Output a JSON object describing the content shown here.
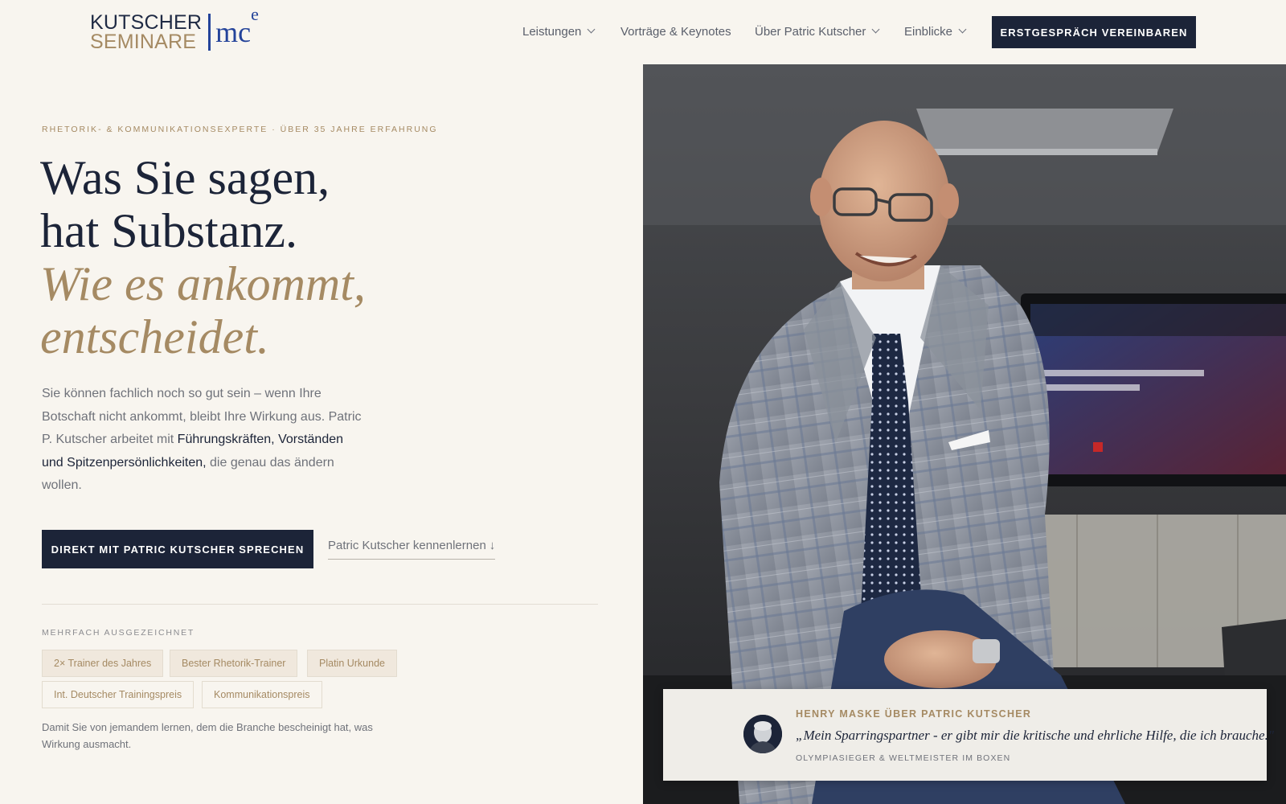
{
  "logo": {
    "line1": "KUTSCHER",
    "line2": "SEMINARE",
    "mark": "mc",
    "mark_sup": "e"
  },
  "nav": {
    "items": [
      {
        "label": "Leistungen",
        "has_dropdown": true
      },
      {
        "label": "Vorträge & Keynotes",
        "has_dropdown": false
      },
      {
        "label": "Über Patric Kutscher",
        "has_dropdown": true
      },
      {
        "label": "Einblicke",
        "has_dropdown": true
      }
    ],
    "cta_label": "ERSTGESPRÄCH VEREINBAREN"
  },
  "hero": {
    "eyebrow": "RHETORIK- & KOMMUNIKATIONSEXPERTE · ÜBER 35 JAHRE ERFAHRUNG",
    "headline": {
      "line1": "Was Sie sagen,",
      "line2": "hat Substanz.",
      "line3": "Wie es ankommt,",
      "line4": "entscheidet."
    },
    "lead": {
      "part1": "Sie können fachlich noch so gut sein – wenn Ihre Botschaft nicht ankommt, bleibt Ihre Wirkung aus. Patric P. Kutscher arbeitet mit ",
      "strong": "Führungskräften, Vorständen und Spitzenpersönlichkeiten,",
      "part2": " die genau das ändern wollen."
    },
    "cta_primary": "DIREKT MIT PATRIC KUTSCHER SPRECHEN",
    "cta_secondary": "Patric Kutscher kennenlernen",
    "cta_secondary_icon": "↓"
  },
  "awards": {
    "label": "MEHRFACH AUSGEZEICHNET",
    "badges": [
      {
        "label": "2× Trainer des Jahres",
        "filled": true
      },
      {
        "label": "Bester Rhetorik-Trainer",
        "filled": true
      },
      {
        "label": "Platin Urkunde",
        "filled": true
      },
      {
        "label": "Int. Deutscher Trainingspreis",
        "filled": false
      },
      {
        "label": "Kommunikationspreis",
        "filled": false
      }
    ],
    "note": "Damit Sie von jemandem lernen, dem die Branche bescheinigt hat, was Wirkung ausmacht."
  },
  "testimonial": {
    "source": "HENRY MASKE ÜBER PATRIC KUTSCHER",
    "quote": "„Mein Sparringspartner - er gibt mir die kritische und ehrliche Hilfe, die ich brauche.\"",
    "role": "OLYMPIASIEGER & WELTMEISTER IM BOXEN"
  },
  "colors": {
    "navy": "#1c2438",
    "gold": "#a58a63",
    "background": "#f8f5ef",
    "logo_blue": "#24439a"
  }
}
